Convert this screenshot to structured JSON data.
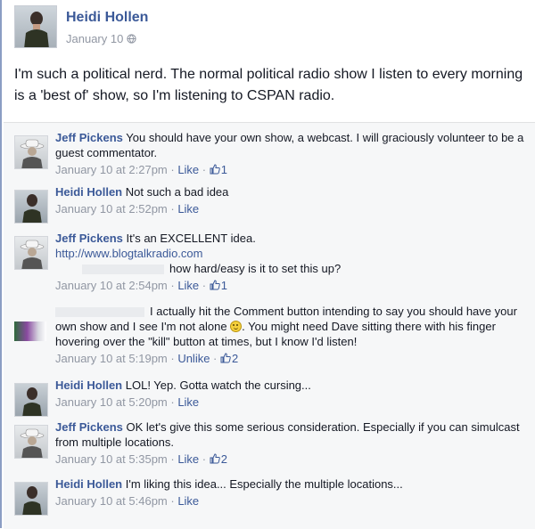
{
  "post": {
    "author": "Heidi Hollen",
    "date": "January 10",
    "text": "I'm such a political nerd. The normal political radio show I listen to every morning is a 'best of' show, so I'm listening to CSPAN radio."
  },
  "comments": [
    {
      "author": "Jeff Pickens",
      "text": "You should have your own show, a webcast. I will graciously volunteer to be a guest commentator.",
      "time": "January 10 at 2:27pm",
      "action": "Like",
      "likes": "1"
    },
    {
      "author": "Heidi Hollen",
      "text": "Not such a bad idea",
      "time": "January 10 at 2:52pm",
      "action": "Like"
    },
    {
      "author": "Jeff Pickens",
      "text": "It's an EXCELLENT idea.",
      "link": "http://www.blogtalkradio.com",
      "text2": "how hard/easy is it to set this up?",
      "time": "January 10 at 2:54pm",
      "action": "Like",
      "likes": "1"
    },
    {
      "text_a": "I actually hit the Comment button intending to say you should have your own show and I see I'm not alone",
      "text_b": ". You might need Dave sitting there with his finger hovering over the \"kill\" button at times, but I know I'd listen!",
      "time": "January 10 at 5:19pm",
      "action": "Unlike",
      "likes": "2"
    },
    {
      "author": "Heidi Hollen",
      "text": "LOL! Yep. Gotta watch the cursing...",
      "time": "January 10 at 5:20pm",
      "action": "Like"
    },
    {
      "author": "Jeff Pickens",
      "text": "OK let's give this some serious consideration. Especially if you can simulcast from multiple locations.",
      "time": "January 10 at 5:35pm",
      "action": "Like",
      "likes": "2"
    },
    {
      "author": "Heidi Hollen",
      "text": "I'm liking this idea... Especially the multiple locations...",
      "time": "January 10 at 5:46pm",
      "action": "Like"
    }
  ],
  "separator": " · ",
  "colors": {
    "link": "#3b5998",
    "meta": "#9197a3",
    "comments_bg": "#f6f7f8"
  },
  "icons": {
    "privacy": "globe-icon",
    "like_count": "thumbs-up-icon",
    "emoticon": "smile-emoticon-icon"
  }
}
